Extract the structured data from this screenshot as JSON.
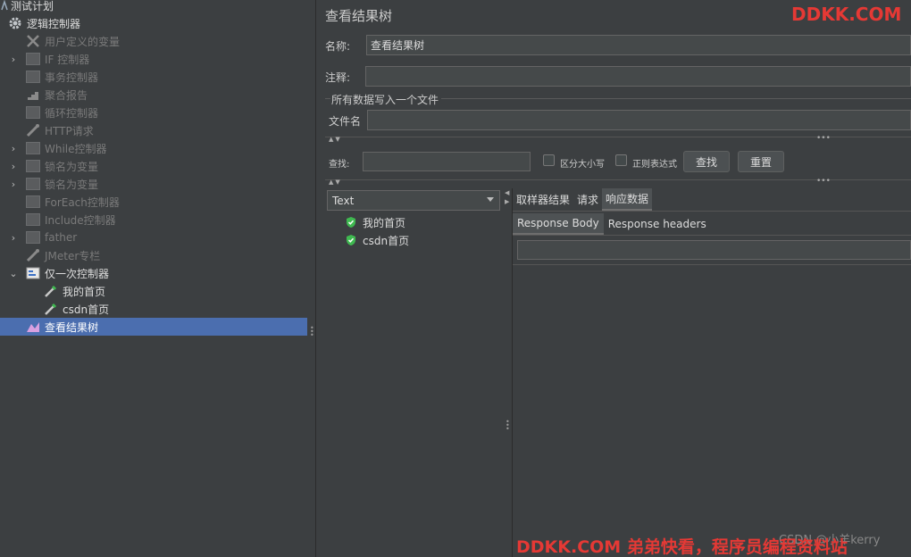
{
  "tree": {
    "items": [
      {
        "label": "测试计划",
        "icon": "test-plan-icon"
      },
      {
        "label": "逻辑控制器",
        "icon": "gear-icon"
      },
      {
        "label": "用户定义的变量",
        "icon": "wrench-icon"
      },
      {
        "label": "IF 控制器",
        "icon": "controller-icon"
      },
      {
        "label": "事务控制器",
        "icon": "controller-icon"
      },
      {
        "label": "聚合报告",
        "icon": "chart-icon"
      },
      {
        "label": "循环控制器",
        "icon": "controller-icon"
      },
      {
        "label": "HTTP请求",
        "icon": "pipette-icon"
      },
      {
        "label": "While控制器",
        "icon": "controller-icon"
      },
      {
        "label": "锁名为变量",
        "icon": "controller-icon"
      },
      {
        "label": "锁名为变量",
        "icon": "controller-icon"
      },
      {
        "label": "ForEach控制器",
        "icon": "controller-icon"
      },
      {
        "label": "Include控制器",
        "icon": "controller-icon"
      },
      {
        "label": "father",
        "icon": "controller-icon"
      },
      {
        "label": "JMeter专栏",
        "icon": "pipette-icon"
      },
      {
        "label": "仅一次控制器",
        "icon": "once-controller-icon"
      },
      {
        "label": "我的首页",
        "icon": "pipette-icon"
      },
      {
        "label": "csdn首页",
        "icon": "pipette-icon"
      },
      {
        "label": "查看结果树",
        "icon": "result-tree-icon"
      }
    ]
  },
  "panel": {
    "title": "查看结果树",
    "name_label": "名称:",
    "name_value": "查看结果树",
    "comment_label": "注释:",
    "comment_value": "",
    "file_group_label": "所有数据写入一个文件",
    "filename_label": "文件名",
    "filename_value": ""
  },
  "search": {
    "label": "查找:",
    "value": "",
    "case_label": "区分大小写",
    "regex_label": "正则表达式",
    "find_button": "查找",
    "reset_button": "重置"
  },
  "results": {
    "renderer": "Text",
    "samples": [
      "我的首页",
      "csdn首页"
    ],
    "tabs": [
      "取样器结果",
      "请求",
      "响应数据"
    ],
    "active_tab": "响应数据",
    "subtabs": [
      "Response Body",
      "Response headers"
    ],
    "active_subtab": "Response Body"
  },
  "watermarks": {
    "top": "DDKK.COM",
    "bottom": "DDKK.COM 弟弟快看，程序员编程资料站",
    "csdn": "CSDN @小羊kerry"
  },
  "colors": {
    "background": "#3c3f41",
    "selection": "#4b6eaf",
    "watermark": "#e53935",
    "check": "#3fb950"
  }
}
